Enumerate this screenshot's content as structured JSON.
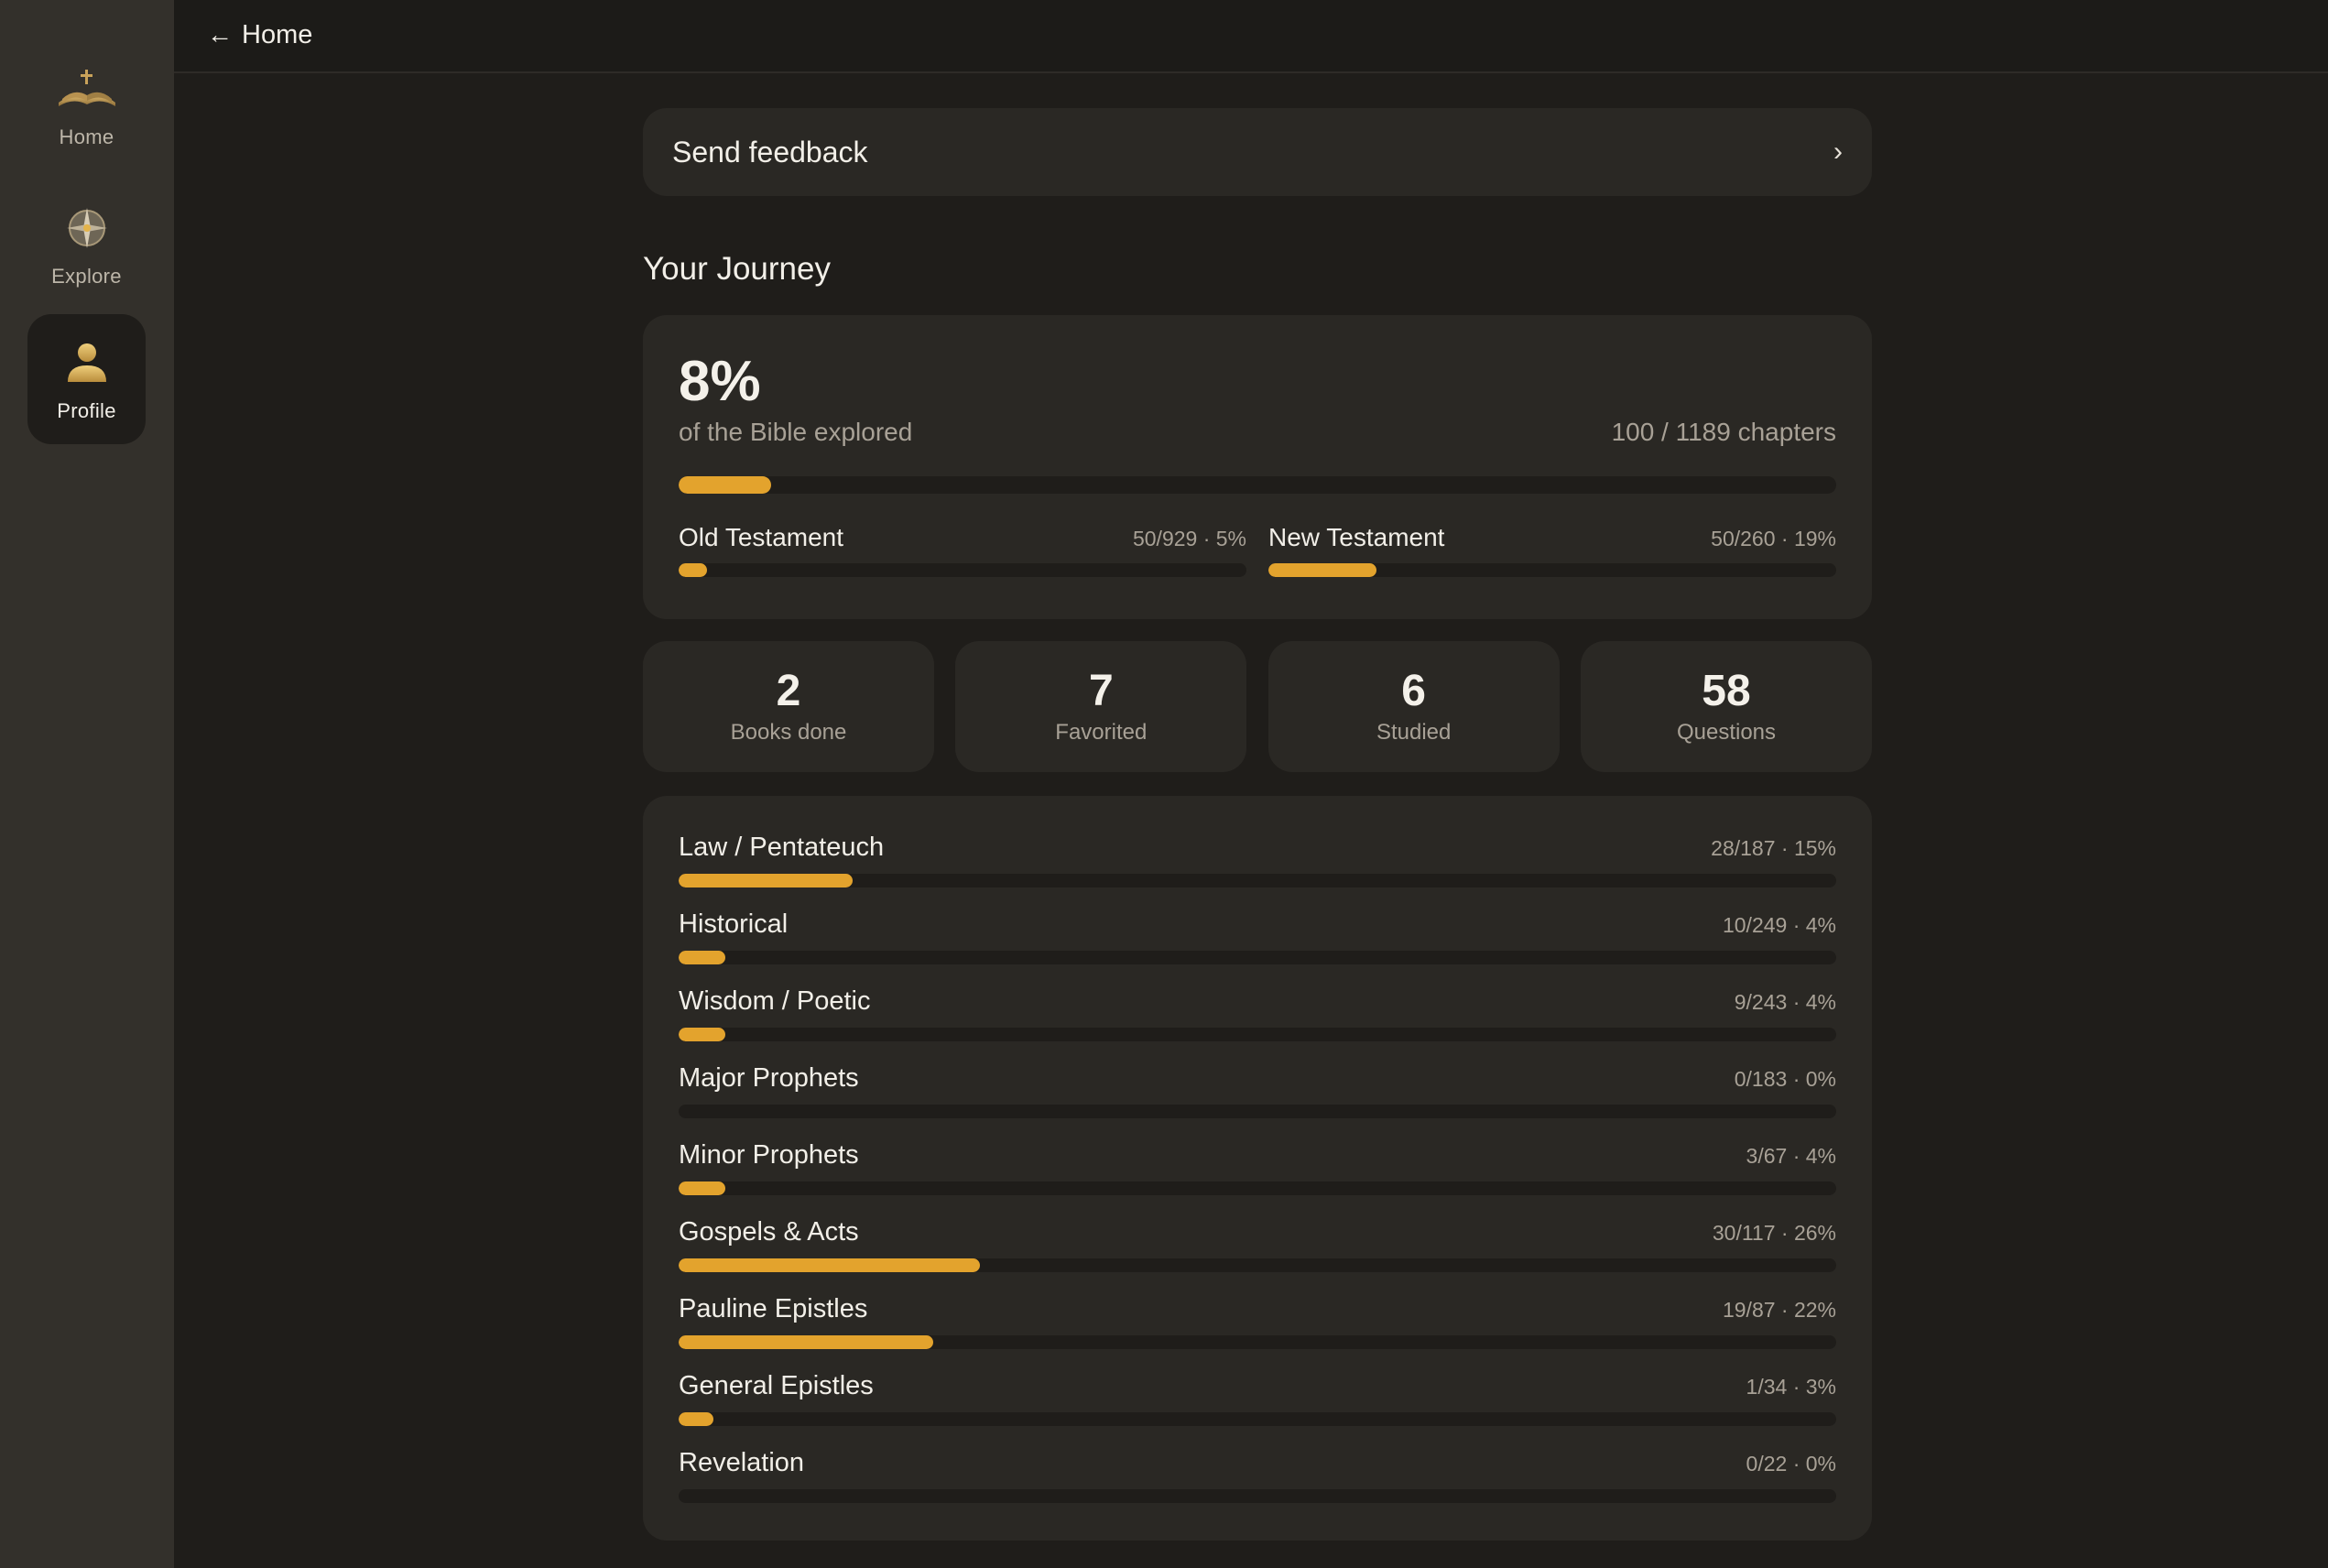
{
  "sidebar": {
    "items": [
      {
        "label": "Home",
        "icon": "bible-icon",
        "active": false
      },
      {
        "label": "Explore",
        "icon": "compass-icon",
        "active": false
      },
      {
        "label": "Profile",
        "icon": "person-icon",
        "active": true
      }
    ]
  },
  "topbar": {
    "back_label": "Home",
    "back_icon": "arrow-left-icon"
  },
  "feedback": {
    "label": "Send feedback",
    "chevron": "›"
  },
  "journey": {
    "title": "Your Journey",
    "percent": "8%",
    "caption": "of the Bible explored",
    "chapters": "100 / 1189 chapters",
    "progress": 0.08,
    "testaments": [
      {
        "name": "Old Testament",
        "value": "50/929 · 5%",
        "progress": 0.05
      },
      {
        "name": "New Testament",
        "value": "50/260 · 19%",
        "progress": 0.19
      }
    ]
  },
  "stats": [
    {
      "value": "2",
      "label": "Books done"
    },
    {
      "value": "7",
      "label": "Favorited"
    },
    {
      "value": "6",
      "label": "Studied"
    },
    {
      "value": "58",
      "label": "Questions"
    }
  ],
  "categories": [
    {
      "name": "Law / Pentateuch",
      "value": "28/187 · 15%",
      "progress": 0.15
    },
    {
      "name": "Historical",
      "value": "10/249 · 4%",
      "progress": 0.04
    },
    {
      "name": "Wisdom / Poetic",
      "value": "9/243 · 4%",
      "progress": 0.04
    },
    {
      "name": "Major Prophets",
      "value": "0/183 · 0%",
      "progress": 0
    },
    {
      "name": "Minor Prophets",
      "value": "3/67 · 4%",
      "progress": 0.04
    },
    {
      "name": "Gospels & Acts",
      "value": "30/117 · 26%",
      "progress": 0.26
    },
    {
      "name": "Pauline Epistles",
      "value": "19/87 · 22%",
      "progress": 0.22
    },
    {
      "name": "General Epistles",
      "value": "1/34 · 3%",
      "progress": 0.03
    },
    {
      "name": "Revelation",
      "value": "0/22 · 0%",
      "progress": 0
    }
  ],
  "colors": {
    "accent": "#e3a32d",
    "background": "#1f1d1a",
    "card": "#2a2824",
    "sidebar": "#33302b"
  }
}
